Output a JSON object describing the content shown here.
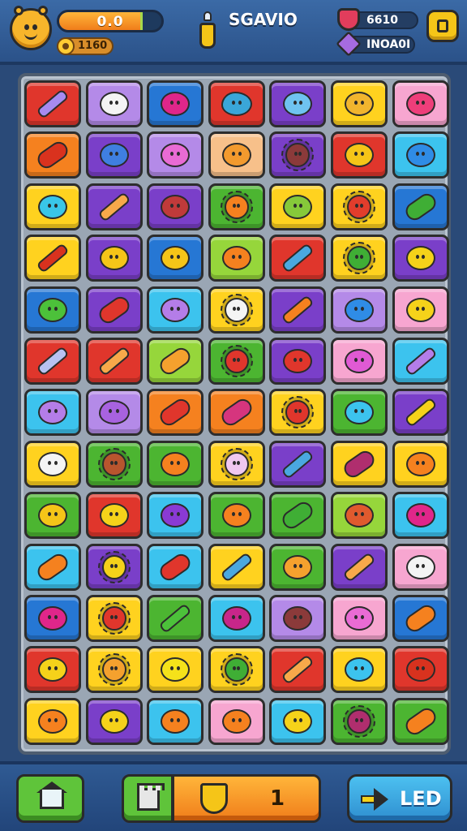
{
  "header": {
    "xp_text": "0.0",
    "xp_fill": 0.82,
    "coins_text": "1160",
    "title": "SGAVIO",
    "hearts_text": "6610",
    "gems_text": "INOA0I"
  },
  "footer": {
    "shield_count": "1",
    "led_label": "LED"
  },
  "colors": {
    "red": "#e0362c",
    "lavender": "#b48ae8",
    "blue": "#2677d4",
    "purple": "#7a3fc9",
    "yellow": "#ffd21f",
    "pink": "#f7a6d0",
    "orange": "#f5811f",
    "cyan": "#3cc3ee",
    "green": "#4cb531",
    "lime": "#96d63b",
    "peach": "#f7c08a"
  },
  "board": {
    "rows": [
      [
        [
          "red",
          "stick",
          "#a78af0"
        ],
        [
          "lavender",
          "round",
          "#f4f4f4"
        ],
        [
          "blue",
          "round",
          "#e0268a"
        ],
        [
          "red",
          "blob",
          "#3aa6d8"
        ],
        [
          "purple",
          "round",
          "#6fc3f0"
        ],
        [
          "yellow",
          "round",
          "#f1b52e"
        ],
        [
          "pink",
          "round",
          "#ee3e7a"
        ]
      ],
      [
        [
          "orange",
          "bean",
          "#d9321e"
        ],
        [
          "purple",
          "round",
          "#3f7fe0"
        ],
        [
          "lavender",
          "round",
          "#e96bd4"
        ],
        [
          "peach",
          "round",
          "#f29a2e"
        ],
        [
          "purple",
          "spiky",
          "#8b3a3a"
        ],
        [
          "red",
          "round",
          "#f5c518"
        ],
        [
          "cyan",
          "round",
          "#2f8ce6"
        ]
      ],
      [
        [
          "yellow",
          "round",
          "#39c6e8"
        ],
        [
          "purple",
          "stick",
          "#f7a94a"
        ],
        [
          "purple",
          "round",
          "#c03a3a"
        ],
        [
          "green",
          "spiky",
          "#f5811f"
        ],
        [
          "yellow",
          "round",
          "#86c93a"
        ],
        [
          "yellow",
          "spiky",
          "#e23d2c"
        ],
        [
          "blue",
          "bean",
          "#3fae35"
        ]
      ],
      [
        [
          "yellow",
          "stick",
          "#d8321e"
        ],
        [
          "purple",
          "round",
          "#f5c518"
        ],
        [
          "blue",
          "round",
          "#f5c518"
        ],
        [
          "lime",
          "round",
          "#f5811f"
        ],
        [
          "red",
          "stick",
          "#4aa8e0"
        ],
        [
          "yellow",
          "spiky",
          "#3fae35"
        ],
        [
          "purple",
          "round",
          "#f5d21a"
        ]
      ],
      [
        [
          "blue",
          "round",
          "#4cc13a"
        ],
        [
          "purple",
          "bean",
          "#e0362c"
        ],
        [
          "cyan",
          "round",
          "#b47de8"
        ],
        [
          "yellow",
          "spiky",
          "#f4f4f4"
        ],
        [
          "purple",
          "stick",
          "#f5811f"
        ],
        [
          "lavender",
          "round",
          "#2f8ce6"
        ],
        [
          "pink",
          "round",
          "#f5d21a"
        ]
      ],
      [
        [
          "red",
          "stick",
          "#b8c2f2"
        ],
        [
          "red",
          "stick",
          "#f7a94a"
        ],
        [
          "lime",
          "bean",
          "#f5a12e"
        ],
        [
          "green",
          "spiky",
          "#e0362c"
        ],
        [
          "purple",
          "round",
          "#e0362c"
        ],
        [
          "pink",
          "round",
          "#e05ad4"
        ],
        [
          "cyan",
          "stick",
          "#b47de8"
        ]
      ],
      [
        [
          "cyan",
          "round",
          "#b47de8"
        ],
        [
          "lavender",
          "blob",
          "#a862e0"
        ],
        [
          "orange",
          "bean",
          "#e0362c"
        ],
        [
          "orange",
          "bean",
          "#d6357e"
        ],
        [
          "yellow",
          "spiky",
          "#e0362c"
        ],
        [
          "green",
          "round",
          "#3cc3ee"
        ],
        [
          "purple",
          "stick",
          "#f5d21a"
        ]
      ],
      [
        [
          "yellow",
          "round",
          "#f4f4f4"
        ],
        [
          "green",
          "spiky",
          "#b8552e"
        ],
        [
          "green",
          "round",
          "#f5811f"
        ],
        [
          "yellow",
          "spiky",
          "#f0c8f0"
        ],
        [
          "purple",
          "stick",
          "#4aa8e0"
        ],
        [
          "yellow",
          "bean",
          "#b02e6e"
        ],
        [
          "yellow",
          "round",
          "#f5811f"
        ]
      ],
      [
        [
          "green",
          "round",
          "#f5c518"
        ],
        [
          "red",
          "round",
          "#f5d21a"
        ],
        [
          "cyan",
          "round",
          "#8a3ad4"
        ],
        [
          "green",
          "round",
          "#f5811f"
        ],
        [
          "green",
          "bean",
          "#3fae35"
        ],
        [
          "lime",
          "round",
          "#e05a2e"
        ],
        [
          "cyan",
          "round",
          "#e0268a"
        ]
      ],
      [
        [
          "cyan",
          "bean",
          "#f5811f"
        ],
        [
          "purple",
          "spiky",
          "#f5d21a"
        ],
        [
          "cyan",
          "bean",
          "#e0362c"
        ],
        [
          "yellow",
          "stick",
          "#4aa8e0"
        ],
        [
          "green",
          "round",
          "#f5a12e"
        ],
        [
          "purple",
          "stick",
          "#f7a94a"
        ],
        [
          "pink",
          "round",
          "#f4f4f4"
        ]
      ],
      [
        [
          "blue",
          "round",
          "#e0268a"
        ],
        [
          "yellow",
          "spiky",
          "#e0362c"
        ],
        [
          "green",
          "stick",
          "#4cc13a"
        ],
        [
          "cyan",
          "round",
          "#c8268a"
        ],
        [
          "lavender",
          "round",
          "#8b3a3a"
        ],
        [
          "pink",
          "round",
          "#e96bd4"
        ],
        [
          "blue",
          "bean",
          "#f5811f"
        ]
      ],
      [
        [
          "red",
          "round",
          "#f5d21a"
        ],
        [
          "yellow",
          "spiky",
          "#f5a12e"
        ],
        [
          "yellow",
          "round",
          "#f5e21a"
        ],
        [
          "yellow",
          "spiky",
          "#3fae35"
        ],
        [
          "red",
          "stick",
          "#f7a94a"
        ],
        [
          "yellow",
          "round",
          "#3cc3ee"
        ],
        [
          "red",
          "round",
          "#d8321e"
        ]
      ],
      [
        [
          "yellow",
          "round",
          "#f5811f"
        ],
        [
          "purple",
          "round",
          "#f5d21a"
        ],
        [
          "cyan",
          "round",
          "#f5811f"
        ],
        [
          "pink",
          "round",
          "#f5811f"
        ],
        [
          "cyan",
          "round",
          "#f5d21a"
        ],
        [
          "green",
          "spiky",
          "#b02e6e"
        ],
        [
          "green",
          "bean",
          "#f5811f"
        ]
      ]
    ]
  }
}
